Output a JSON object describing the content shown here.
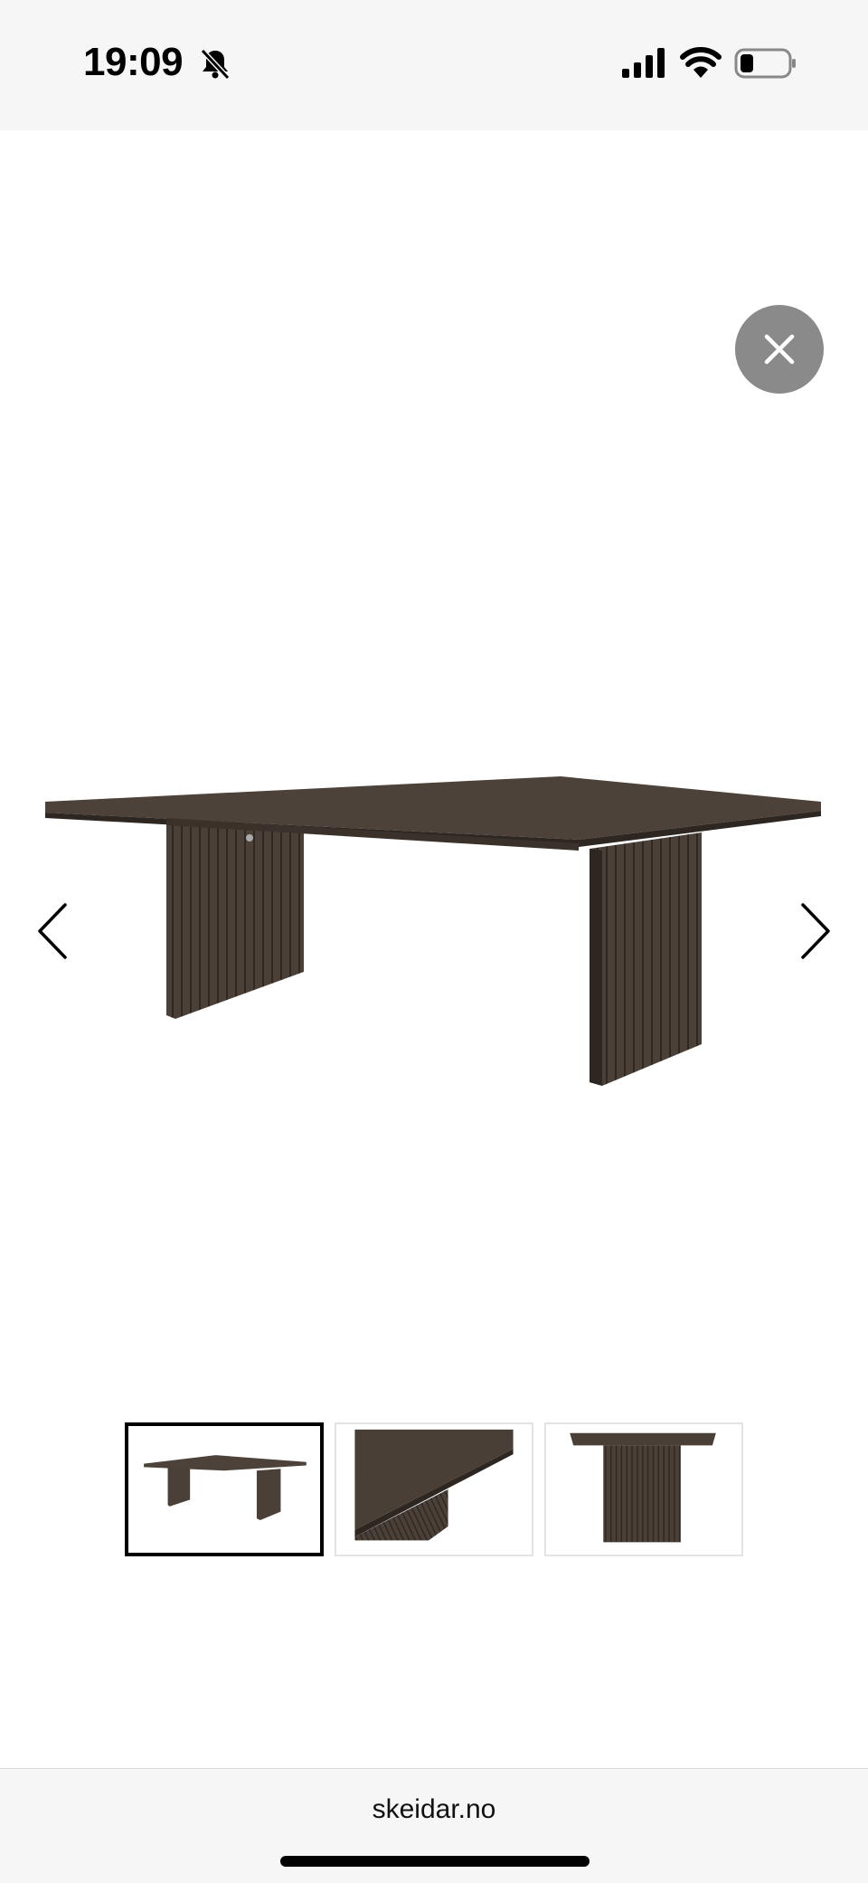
{
  "status_bar": {
    "time": "19:09",
    "icons": [
      "bell-slash-icon",
      "cellular-signal-icon",
      "wifi-icon",
      "battery-icon"
    ]
  },
  "gallery": {
    "close_icon": "close-icon",
    "prev_icon": "chevron-left-icon",
    "next_icon": "chevron-right-icon",
    "thumbnails": [
      {
        "name": "thumbnail-1",
        "selected": true
      },
      {
        "name": "thumbnail-2",
        "selected": false
      },
      {
        "name": "thumbnail-3",
        "selected": false
      }
    ]
  },
  "browser": {
    "url": "skeidar.no"
  },
  "colors": {
    "wood": "#4a3f37",
    "wood_dark": "#3a312b",
    "close_bg": "#8a8a8a",
    "bar_bg": "#f6f6f6"
  }
}
